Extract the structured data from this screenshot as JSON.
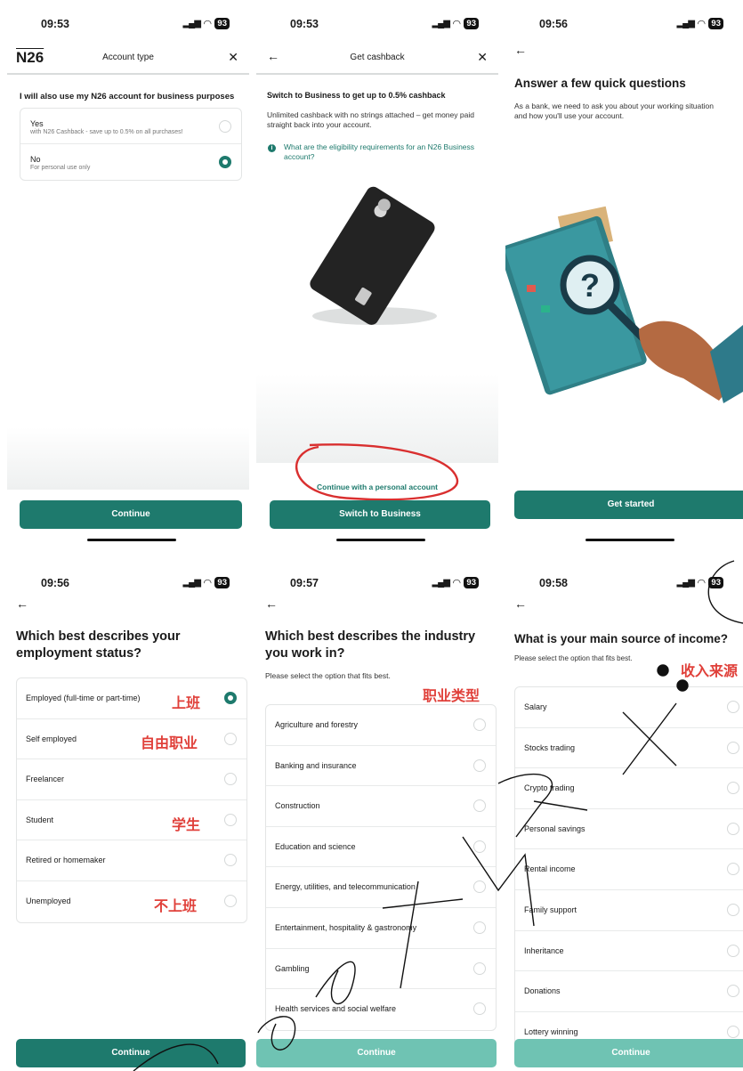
{
  "status": {
    "p1": {
      "time": "09:53",
      "battery": "93"
    },
    "p2": {
      "time": "09:53",
      "battery": "93"
    },
    "p3": {
      "time": "09:56",
      "battery": "93"
    },
    "p4": {
      "time": "09:56",
      "battery": "93"
    },
    "p5": {
      "time": "09:57",
      "battery": "93"
    },
    "p6": {
      "time": "09:58",
      "battery": "93"
    }
  },
  "icons": {
    "back": "←",
    "close": "✕",
    "signal": "▂▄▆",
    "wifi": "wifi-icon"
  },
  "accent": "#1e7a6d",
  "panel1": {
    "logo": "N26",
    "title": "Account type",
    "question": "I will also use my N26 account for business purposes",
    "options": [
      {
        "label": "Yes",
        "sub": "with N26 Cashback - save up to 0.5% on all purchases!",
        "selected": false
      },
      {
        "label": "No",
        "sub": "For personal use only",
        "selected": true
      }
    ],
    "button": "Continue"
  },
  "panel2": {
    "title": "Get cashback",
    "heading": "Switch to Business to get up to 0.5% cashback",
    "body": "Unlimited cashback with no strings attached – get money paid straight back into your account.",
    "link": "What are the eligibility requirements for an N26 Business account?",
    "secondary": "Continue with a personal account",
    "button": "Switch to Business"
  },
  "panel3": {
    "title": "Answer a few quick questions",
    "body": "As a bank, we need to ask you about your working situation and how you'll use your account.",
    "button": "Get started"
  },
  "panel4": {
    "title": "Which best describes your employment status?",
    "options": [
      "Employed (full-time or part-time)",
      "Self employed",
      "Freelancer",
      "Student",
      "Retired or homemaker",
      "Unemployed"
    ],
    "annotations": [
      "上班",
      "自由职业",
      "学生",
      "不上班"
    ],
    "button": "Continue"
  },
  "panel5": {
    "title": "Which best describes the industry you work in?",
    "sub": "Please select the option that fits best.",
    "annotation": "职业类型",
    "options": [
      "Agriculture and forestry",
      "Banking and insurance",
      "Construction",
      "Education and science",
      "Energy, utilities, and telecommunication",
      "Entertainment, hospitality & gastronomy",
      "Gambling",
      "Health services and social welfare"
    ],
    "button": "Continue"
  },
  "panel6": {
    "title": "What is your main source of income?",
    "sub": "Please select the option that fits best.",
    "annotation": "收入来源",
    "options": [
      "Salary",
      "Stocks trading",
      "Crypto trading",
      "Personal savings",
      "Rental income",
      "Family support",
      "Inheritance",
      "Donations",
      "Lottery winning"
    ],
    "button": "Continue"
  }
}
